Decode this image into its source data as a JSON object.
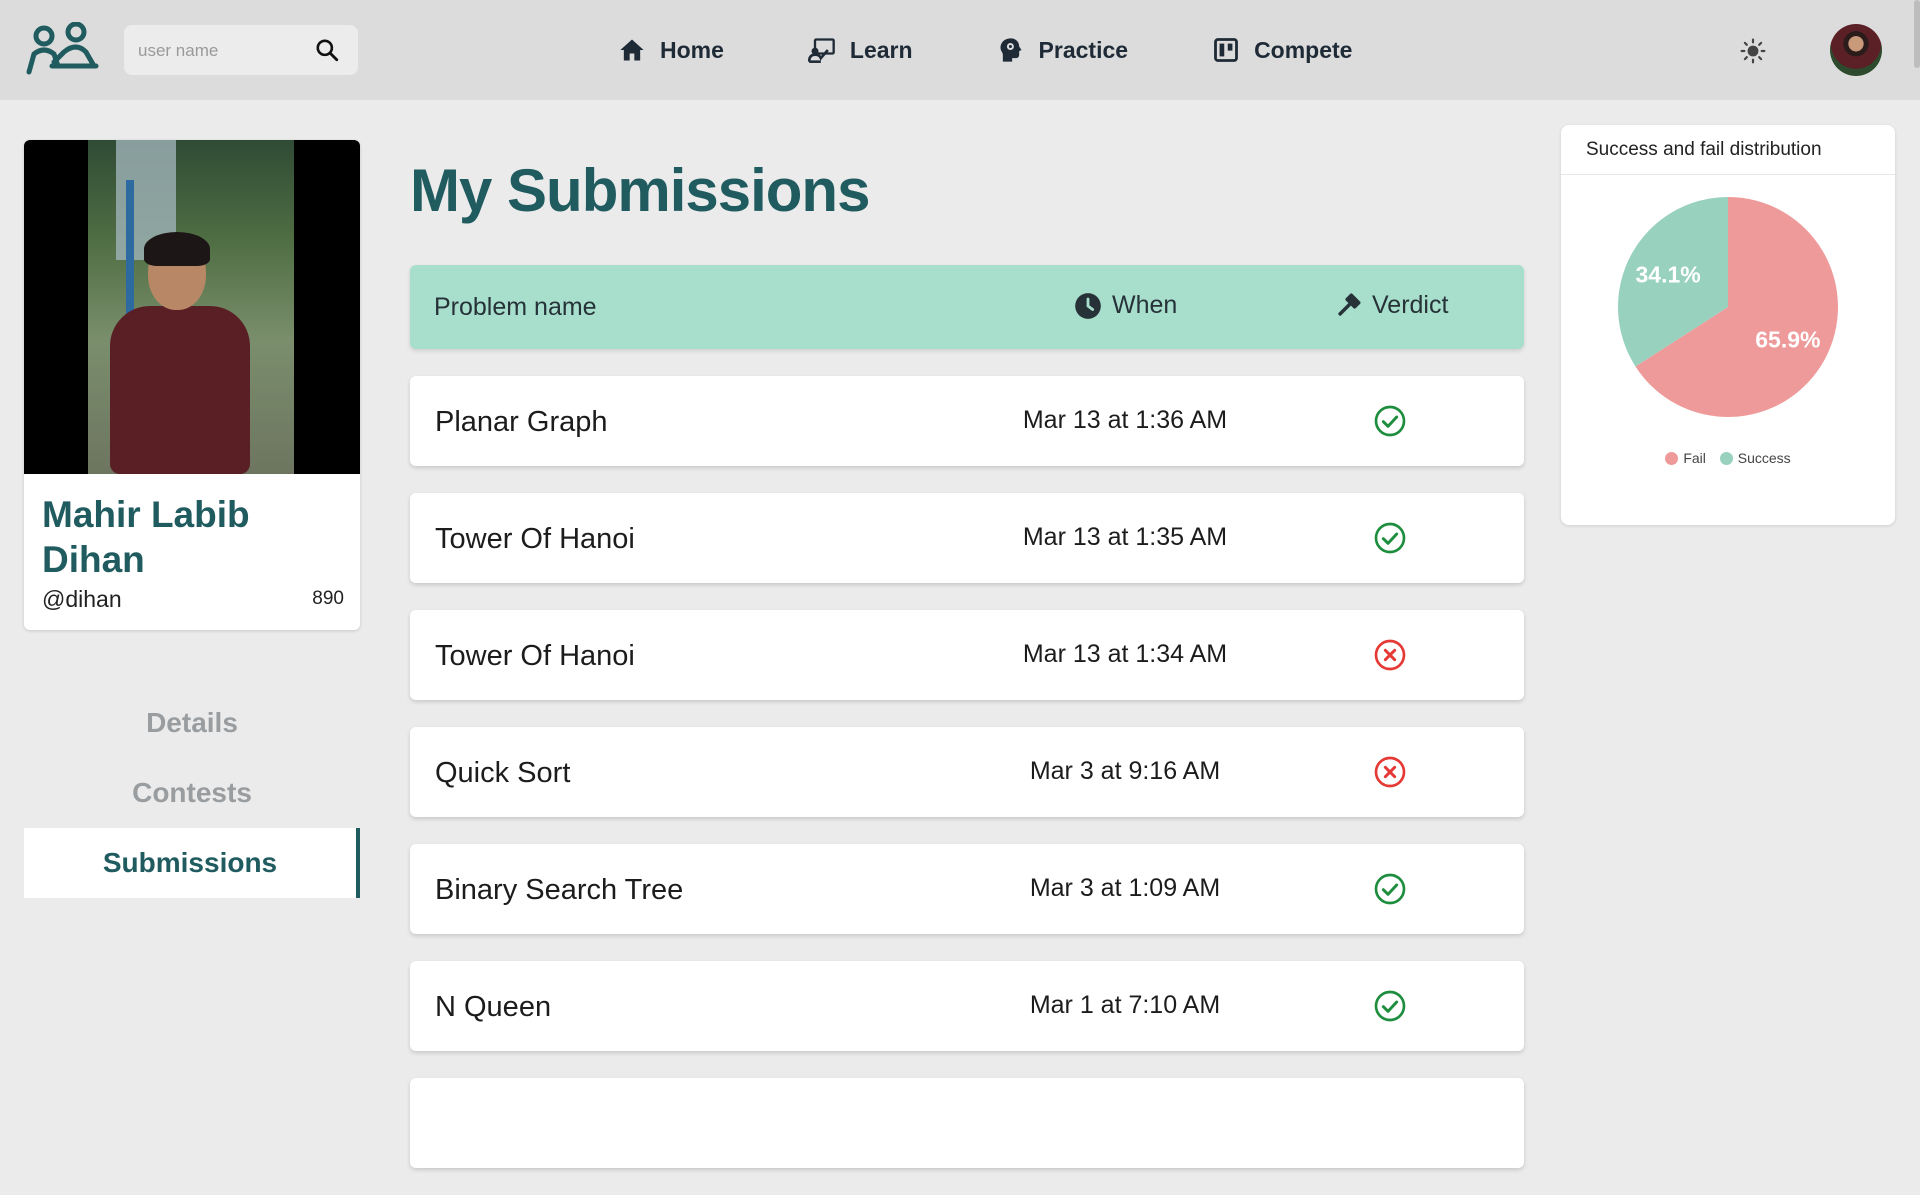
{
  "nav": {
    "search_placeholder": "user name",
    "links": [
      {
        "label": "Home",
        "icon": "home-icon"
      },
      {
        "label": "Learn",
        "icon": "learn-icon"
      },
      {
        "label": "Practice",
        "icon": "practice-icon"
      },
      {
        "label": "Compete",
        "icon": "compete-icon"
      }
    ]
  },
  "profile": {
    "name": "Mahir Labib Dihan",
    "handle": "@dihan",
    "rating": "890"
  },
  "sidenav": {
    "items": [
      {
        "label": "Details",
        "active": false
      },
      {
        "label": "Contests",
        "active": false
      },
      {
        "label": "Submissions",
        "active": true
      }
    ]
  },
  "main": {
    "title": "My Submissions",
    "columns": {
      "problem": "Problem name",
      "when": "When",
      "verdict": "Verdict"
    },
    "rows": [
      {
        "problem": "Planar Graph",
        "when": "Mar 13 at 1:36 AM",
        "verdict": "success"
      },
      {
        "problem": "Tower Of Hanoi",
        "when": "Mar 13 at 1:35 AM",
        "verdict": "success"
      },
      {
        "problem": "Tower Of Hanoi",
        "when": "Mar 13 at 1:34 AM",
        "verdict": "fail"
      },
      {
        "problem": "Quick Sort",
        "when": "Mar 3 at 9:16 AM",
        "verdict": "fail"
      },
      {
        "problem": "Binary Search Tree",
        "when": "Mar 3 at 1:09 AM",
        "verdict": "success"
      },
      {
        "problem": "N Queen",
        "when": "Mar 1 at 7:10 AM",
        "verdict": "success"
      }
    ]
  },
  "colors": {
    "brand": "#1f5b5f",
    "header_bg": "#a8dfcc",
    "success": "#1e8e3e",
    "fail": "#e53935"
  },
  "chart_data": {
    "type": "pie",
    "title": "Success and fail distribution",
    "slices": [
      {
        "name": "Fail",
        "value": 65.9,
        "label": "65.9%",
        "color": "#ef9a9a"
      },
      {
        "name": "Success",
        "value": 34.1,
        "label": "34.1%",
        "color": "#99d1bf"
      }
    ],
    "legend": "bottom-center"
  }
}
